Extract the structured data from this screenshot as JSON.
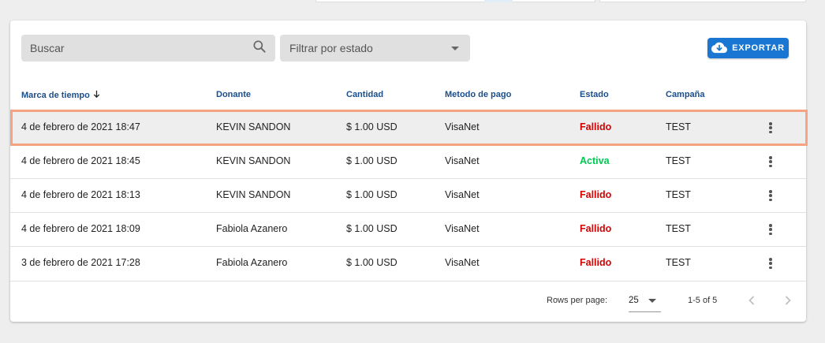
{
  "toolbar": {
    "search_placeholder": "Buscar",
    "filter_placeholder": "Filtrar por estado",
    "export_label": "EXPORTAR"
  },
  "table": {
    "columns": [
      {
        "label": "Marca de tiempo",
        "sorted": "desc"
      },
      {
        "label": "Donante"
      },
      {
        "label": "Cantidad"
      },
      {
        "label": "Metodo de pago"
      },
      {
        "label": "Estado"
      },
      {
        "label": "Campaña"
      }
    ],
    "rows": [
      {
        "timestamp": "4 de febrero de 2021 18:47",
        "donor": "KEVIN SANDON",
        "amount": "$ 1.00 USD",
        "method": "VisaNet",
        "status": "Fallido",
        "campaign": "TEST"
      },
      {
        "timestamp": "4 de febrero de 2021 18:45",
        "donor": "KEVIN SANDON",
        "amount": "$ 1.00 USD",
        "method": "VisaNet",
        "status": "Activa",
        "campaign": "TEST"
      },
      {
        "timestamp": "4 de febrero de 2021 18:13",
        "donor": "KEVIN SANDON",
        "amount": "$ 1.00 USD",
        "method": "VisaNet",
        "status": "Fallido",
        "campaign": "TEST"
      },
      {
        "timestamp": "4 de febrero de 2021 18:09",
        "donor": "Fabiola Azanero",
        "amount": "$ 1.00 USD",
        "method": "VisaNet",
        "status": "Fallido",
        "campaign": "TEST"
      },
      {
        "timestamp": "3 de febrero de 2021 17:28",
        "donor": "Fabiola Azanero",
        "amount": "$ 1.00 USD",
        "method": "VisaNet",
        "status": "Fallido",
        "campaign": "TEST"
      }
    ]
  },
  "pagination": {
    "rows_per_page_label": "Rows per page:",
    "rows_per_page_value": "25",
    "range": "1-5 of 5"
  },
  "colors": {
    "header_text": "#1a4e8c",
    "status_failed": "#d50000",
    "status_active": "#00c853",
    "export_button": "#1976d2",
    "row_highlight": "#f4a482"
  },
  "icons": {
    "search": "search-icon",
    "filter_caret": "arrow-drop-down-icon",
    "export": "cloud-download-icon",
    "sort": "arrow-down-icon",
    "row_menu": "more-vert-icon",
    "prev": "chevron-left-icon",
    "next": "chevron-right-icon"
  }
}
